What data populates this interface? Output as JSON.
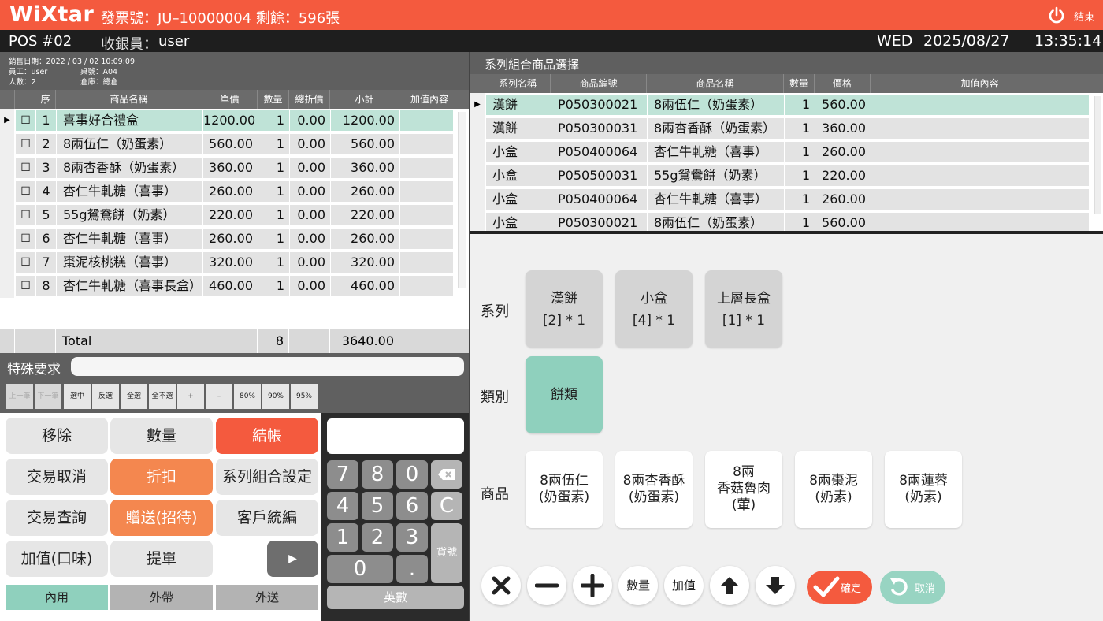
{
  "header": {
    "logo": "WiXtar",
    "invoice": "發票號：JU–10000004 剩餘：596張",
    "exit_label": "結束",
    "accent_color": "#f45a3e"
  },
  "subheader": {
    "pos": "POS #02",
    "cashier_label": "收銀員：",
    "cashier_name": "user",
    "weekday": "WED",
    "date": "2025/08/27",
    "time": "13:35:14"
  },
  "sale_info": {
    "date": "銷售日期：2022 / 03 / 02  10:09:09",
    "staff": "員工：user",
    "table": "桌號：A04",
    "people": "人數：2",
    "warehouse": "倉庫：總倉"
  },
  "order": {
    "columns": [
      "序",
      "商品名稱",
      "單價",
      "數量",
      "總折價",
      "小計",
      "加值內容"
    ],
    "rows": [
      {
        "seq": "1",
        "name": "喜事好合禮盒",
        "price": "1200.00",
        "qty": "1",
        "disc": "0.00",
        "subtotal": "1200.00",
        "selected": true
      },
      {
        "seq": "2",
        "name": "8兩伍仁（奶蛋素）",
        "price": "560.00",
        "qty": "1",
        "disc": "0.00",
        "subtotal": "560.00"
      },
      {
        "seq": "3",
        "name": "8兩杏香酥（奶蛋素）",
        "price": "360.00",
        "qty": "1",
        "disc": "0.00",
        "subtotal": "360.00"
      },
      {
        "seq": "4",
        "name": "杏仁牛軋糖（喜事）",
        "price": "260.00",
        "qty": "1",
        "disc": "0.00",
        "subtotal": "260.00"
      },
      {
        "seq": "5",
        "name": "55g鴛鴦餅（奶素）",
        "price": "220.00",
        "qty": "1",
        "disc": "0.00",
        "subtotal": "220.00"
      },
      {
        "seq": "6",
        "name": "杏仁牛軋糖（喜事）",
        "price": "260.00",
        "qty": "1",
        "disc": "0.00",
        "subtotal": "260.00"
      },
      {
        "seq": "7",
        "name": "棗泥核桃糕（喜事）",
        "price": "320.00",
        "qty": "1",
        "disc": "0.00",
        "subtotal": "320.00"
      },
      {
        "seq": "8",
        "name": "杏仁牛軋糖（喜事長盒）",
        "price": "460.00",
        "qty": "1",
        "disc": "0.00",
        "subtotal": "460.00"
      }
    ],
    "total_label": "Total",
    "total_qty": "8",
    "total_amount": "3640.00"
  },
  "special": {
    "label": "特殊要求",
    "value": ""
  },
  "small_buttons": [
    "上一筆",
    "下一筆",
    "選中",
    "反選",
    "全選",
    "全不選",
    "+",
    "–",
    "80%",
    "90%",
    "95%"
  ],
  "actions": {
    "remove": "移除",
    "quantity": "數量",
    "checkout": "結帳",
    "cancel_tx": "交易取消",
    "discount": "折扣",
    "combo_setting": "系列組合設定",
    "query_tx": "交易查詢",
    "gift": "贈送(招待)",
    "customer_id": "客戶統編",
    "addon": "加值(口味)",
    "pickup": "提單",
    "dine_in": "內用",
    "takeout": "外帶",
    "delivery": "外送"
  },
  "keypad": {
    "display": "",
    "keys": [
      "7",
      "8",
      "0",
      "4",
      "5",
      "6",
      "1",
      "2",
      "3",
      "0",
      "."
    ],
    "clear": "C",
    "goods_no": "貨號",
    "alnum": "英數"
  },
  "combo": {
    "title": "系列組合商品選擇",
    "columns": [
      "系列名稱",
      "商品編號",
      "商品名稱",
      "數量",
      "價格",
      "加值內容"
    ],
    "rows": [
      {
        "series": "漢餅",
        "code": "P050300021",
        "name": "8兩伍仁（奶蛋素）",
        "qty": "1",
        "price": "560.00",
        "selected": true
      },
      {
        "series": "漢餅",
        "code": "P050300031",
        "name": "8兩杏香酥（奶蛋素）",
        "qty": "1",
        "price": "360.00"
      },
      {
        "series": "小盒",
        "code": "P050400064",
        "name": "杏仁牛軋糖（喜事）",
        "qty": "1",
        "price": "260.00"
      },
      {
        "series": "小盒",
        "code": "P050500031",
        "name": "55g鴛鴦餅（奶素）",
        "qty": "1",
        "price": "220.00"
      },
      {
        "series": "小盒",
        "code": "P050400064",
        "name": "杏仁牛軋糖（喜事）",
        "qty": "1",
        "price": "260.00"
      },
      {
        "series": "小盒",
        "code": "P050300021",
        "name": "8兩伍仁（奶蛋素）",
        "qty": "1",
        "price": "560.00"
      }
    ]
  },
  "selector": {
    "series_label": "系列",
    "series": [
      {
        "name": "漢餅",
        "count": "[2] * 1"
      },
      {
        "name": "小盒",
        "count": "[4] * 1"
      },
      {
        "name": "上層長盒",
        "count": "[1] * 1"
      }
    ],
    "category_label": "類別",
    "category": "餅類",
    "goods_label": "商品",
    "goods": [
      [
        "8兩伍仁",
        "(奶蛋素)"
      ],
      [
        "8兩杏香酥",
        "(奶蛋素)"
      ],
      [
        "8兩",
        "香菇魯肉",
        "(葷)"
      ],
      [
        "8兩棗泥",
        "(奶素)"
      ],
      [
        "8兩蓮蓉",
        "(奶素)"
      ]
    ],
    "qty_btn": "數量",
    "addon_btn": "加值",
    "ok": "確定",
    "cancel": "取消"
  }
}
